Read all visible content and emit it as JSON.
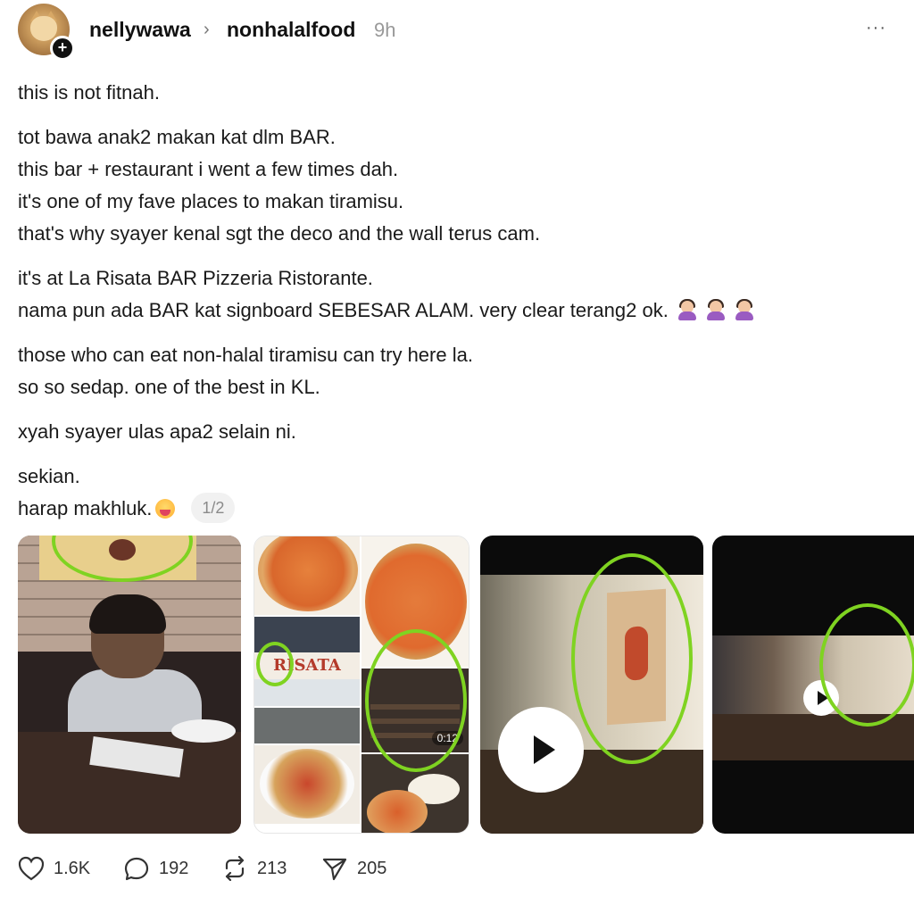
{
  "header": {
    "username": "nellywawa",
    "community": "nonhalalfood",
    "time": "9h",
    "follow_symbol": "+",
    "chevron": "›",
    "more": "···"
  },
  "post": {
    "paragraphs": [
      [
        "this is not fitnah."
      ],
      [
        "tot bawa anak2 makan kat dlm BAR.",
        "this bar + restaurant i went a few times dah.",
        "it's one of my fave places to makan tiramisu.",
        "that's why syayer kenal sgt the deco and the wall terus cam."
      ],
      [
        "it's at La Risata BAR Pizzeria Ristorante.",
        "nama pun ada BAR kat signboard SEBESAR ALAM. very clear terang2 ok."
      ],
      [
        "those who can eat non-halal tiramisu can try here la.",
        "so so sedap. one of the best in KL."
      ],
      [
        "xyah syayer ulas apa2 selain ni."
      ],
      [
        "sekian.",
        "harap makhluk."
      ]
    ],
    "page_indicator": "1/2"
  },
  "media": {
    "collage_sign_text": "RISATA",
    "video_duration": "0:12"
  },
  "actions": {
    "likes": "1.6K",
    "replies": "192",
    "reposts": "213",
    "shares": "205"
  },
  "colors": {
    "highlight_ring": "#7fd321",
    "text": "#1a1a1a",
    "muted": "#999999"
  }
}
